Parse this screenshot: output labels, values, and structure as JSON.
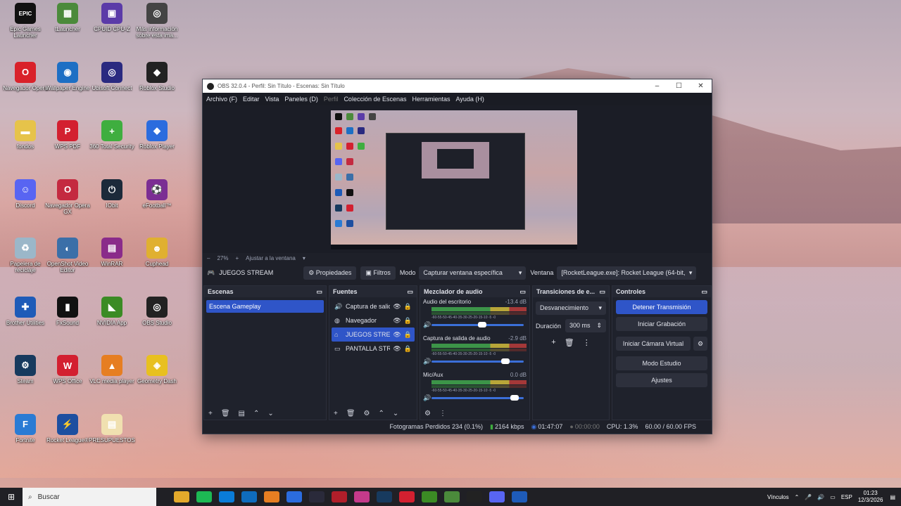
{
  "desktop_icons": [
    {
      "label": "Epic Games Launcher",
      "color": "#111111",
      "glyph": "EPIC"
    },
    {
      "label": "tLauncher",
      "color": "#4b8a3b",
      "glyph": "▦"
    },
    {
      "label": "CPUID CPU-Z",
      "color": "#5b3ba8",
      "glyph": "▣"
    },
    {
      "label": "Más información sobre esta ima...",
      "color": "#444444",
      "glyph": "◎"
    },
    {
      "label": "Navegador Opera",
      "color": "#d9222a",
      "glyph": "O"
    },
    {
      "label": "Wallpaper Engine",
      "color": "#1d6fc4",
      "glyph": "◉"
    },
    {
      "label": "Ubisoft Connect",
      "color": "#2a2a80",
      "glyph": "◎"
    },
    {
      "label": "Roblox Studio",
      "color": "#222222",
      "glyph": "◆"
    },
    {
      "label": "fondos",
      "color": "#e6c34a",
      "glyph": "▬"
    },
    {
      "label": "WPS PDF",
      "color": "#d32030",
      "glyph": "P"
    },
    {
      "label": "360 Total Security",
      "color": "#3fae3f",
      "glyph": "+"
    },
    {
      "label": "Roblox Player",
      "color": "#2b6cde",
      "glyph": "◆"
    },
    {
      "label": "Discord",
      "color": "#5865f2",
      "glyph": "☺"
    },
    {
      "label": "Navegador Opera GX",
      "color": "#c42a40",
      "glyph": "O"
    },
    {
      "label": "IObit",
      "color": "#1c2a3a",
      "glyph": "⏻"
    },
    {
      "label": "eFootball™",
      "color": "#7b2e93",
      "glyph": "⚽"
    },
    {
      "label": "Papelera de reciclaje",
      "color": "#9bb7c9",
      "glyph": "♻"
    },
    {
      "label": "OpenShot Video Editor",
      "color": "#3b6fa8",
      "glyph": "◐"
    },
    {
      "label": "WinRAR",
      "color": "#8a2b8a",
      "glyph": "▤"
    },
    {
      "label": "Cuphead",
      "color": "#e0b030",
      "glyph": "☻"
    },
    {
      "label": "Brother Utilities",
      "color": "#1e5bb8",
      "glyph": "✚"
    },
    {
      "label": "FxSound",
      "color": "#111111",
      "glyph": "▮"
    },
    {
      "label": "NVIDIA App",
      "color": "#3b8b24",
      "glyph": "◣"
    },
    {
      "label": "OBS Studio",
      "color": "#222222",
      "glyph": "◎"
    },
    {
      "label": "Steam",
      "color": "#173a5e",
      "glyph": "⚙"
    },
    {
      "label": "WPS Office",
      "color": "#d32030",
      "glyph": "W"
    },
    {
      "label": "VLC media player",
      "color": "#e67e22",
      "glyph": "▲"
    },
    {
      "label": "Geometry Dash",
      "color": "#e8c020",
      "glyph": "◈"
    },
    {
      "label": "Fortnite",
      "color": "#2a7bd4",
      "glyph": "F"
    },
    {
      "label": "Rocket League®",
      "color": "#1d4fa0",
      "glyph": "⚡"
    },
    {
      "label": "PRESUPUESTOS",
      "color": "#f0e0b0",
      "glyph": "▤"
    }
  ],
  "obs": {
    "title": "OBS 32.0.4 - Perfil: Sin Título - Escenas: Sin Título",
    "menu": [
      "Archivo (F)",
      "Editar",
      "Vista",
      "Paneles (D)",
      "Perfil",
      "Colección de Escenas",
      "Herramientas",
      "Ayuda (H)"
    ],
    "zoom": {
      "minus": "–",
      "value": "27%",
      "plus": "+",
      "fit": "Ajustar a la ventana",
      "arrow": "▾"
    },
    "source_bar": {
      "current": "JUEGOS STREAM",
      "properties": "Propiedades",
      "filters": "Filtros",
      "mode_label": "Modo",
      "mode_value": "Capturar ventana específica",
      "window_label": "Ventana",
      "window_value": "[RocketLeague.exe]: Rocket League (64-bit,"
    },
    "scenes": {
      "title": "Escenas",
      "items": [
        "Escena Gameplay"
      ]
    },
    "sources": {
      "title": "Fuentes",
      "items": [
        {
          "name": "Captura de salid",
          "icon": "🔊"
        },
        {
          "name": "Navegador",
          "icon": "◍"
        },
        {
          "name": "JUEGOS STREAM",
          "icon": "⌂"
        },
        {
          "name": "PANTALLA STREA",
          "icon": "▭"
        }
      ]
    },
    "mixer": {
      "title": "Mezclador de audio",
      "channels": [
        {
          "name": "Audio del escritorio",
          "db": "-13.4 dB",
          "volume": 0.55
        },
        {
          "name": "Captura de salida de audio",
          "db": "-2.9 dB",
          "volume": 0.8
        },
        {
          "name": "Mic/Aux",
          "db": "0.0 dB",
          "volume": 0.9
        }
      ],
      "scale": "-60-55-50-45-40-35-30-25-20-15-10 -5 -0"
    },
    "transitions": {
      "title": "Transiciones de e...",
      "type": "Desvanecimiento",
      "duration_label": "Duración",
      "duration_value": "300 ms"
    },
    "controls": {
      "title": "Controles",
      "buttons": [
        "Detener Transmisión",
        "Iniciar Grabación",
        "Iniciar Cámara Virtual",
        "Modo Estudio",
        "Ajustes"
      ]
    },
    "status": {
      "dropped": "Fotogramas Perdidos 234 (0.1%)",
      "bitrate": "2164 kbps",
      "stream_time": "01:47:07",
      "rec_time": "00:00:00",
      "cpu": "CPU: 1.3%",
      "fps": "60.00 / 60.00 FPS"
    }
  },
  "taskbar": {
    "search_placeholder": "Buscar",
    "apps": [
      "#e3a92b",
      "#1db954",
      "#0a7cd8",
      "#0f6cbd",
      "#e67e22",
      "#2b6cde",
      "#2a2a3a",
      "#b01e2a",
      "#c43a8b",
      "#173a5e",
      "#d32030",
      "#3b8b24",
      "#4b8a3b",
      "#222222",
      "#5865f2",
      "#1e5bb8"
    ],
    "vinculos": "Vínculos",
    "lang": "ESP",
    "time": "01:23",
    "date": "12/3/2026"
  }
}
